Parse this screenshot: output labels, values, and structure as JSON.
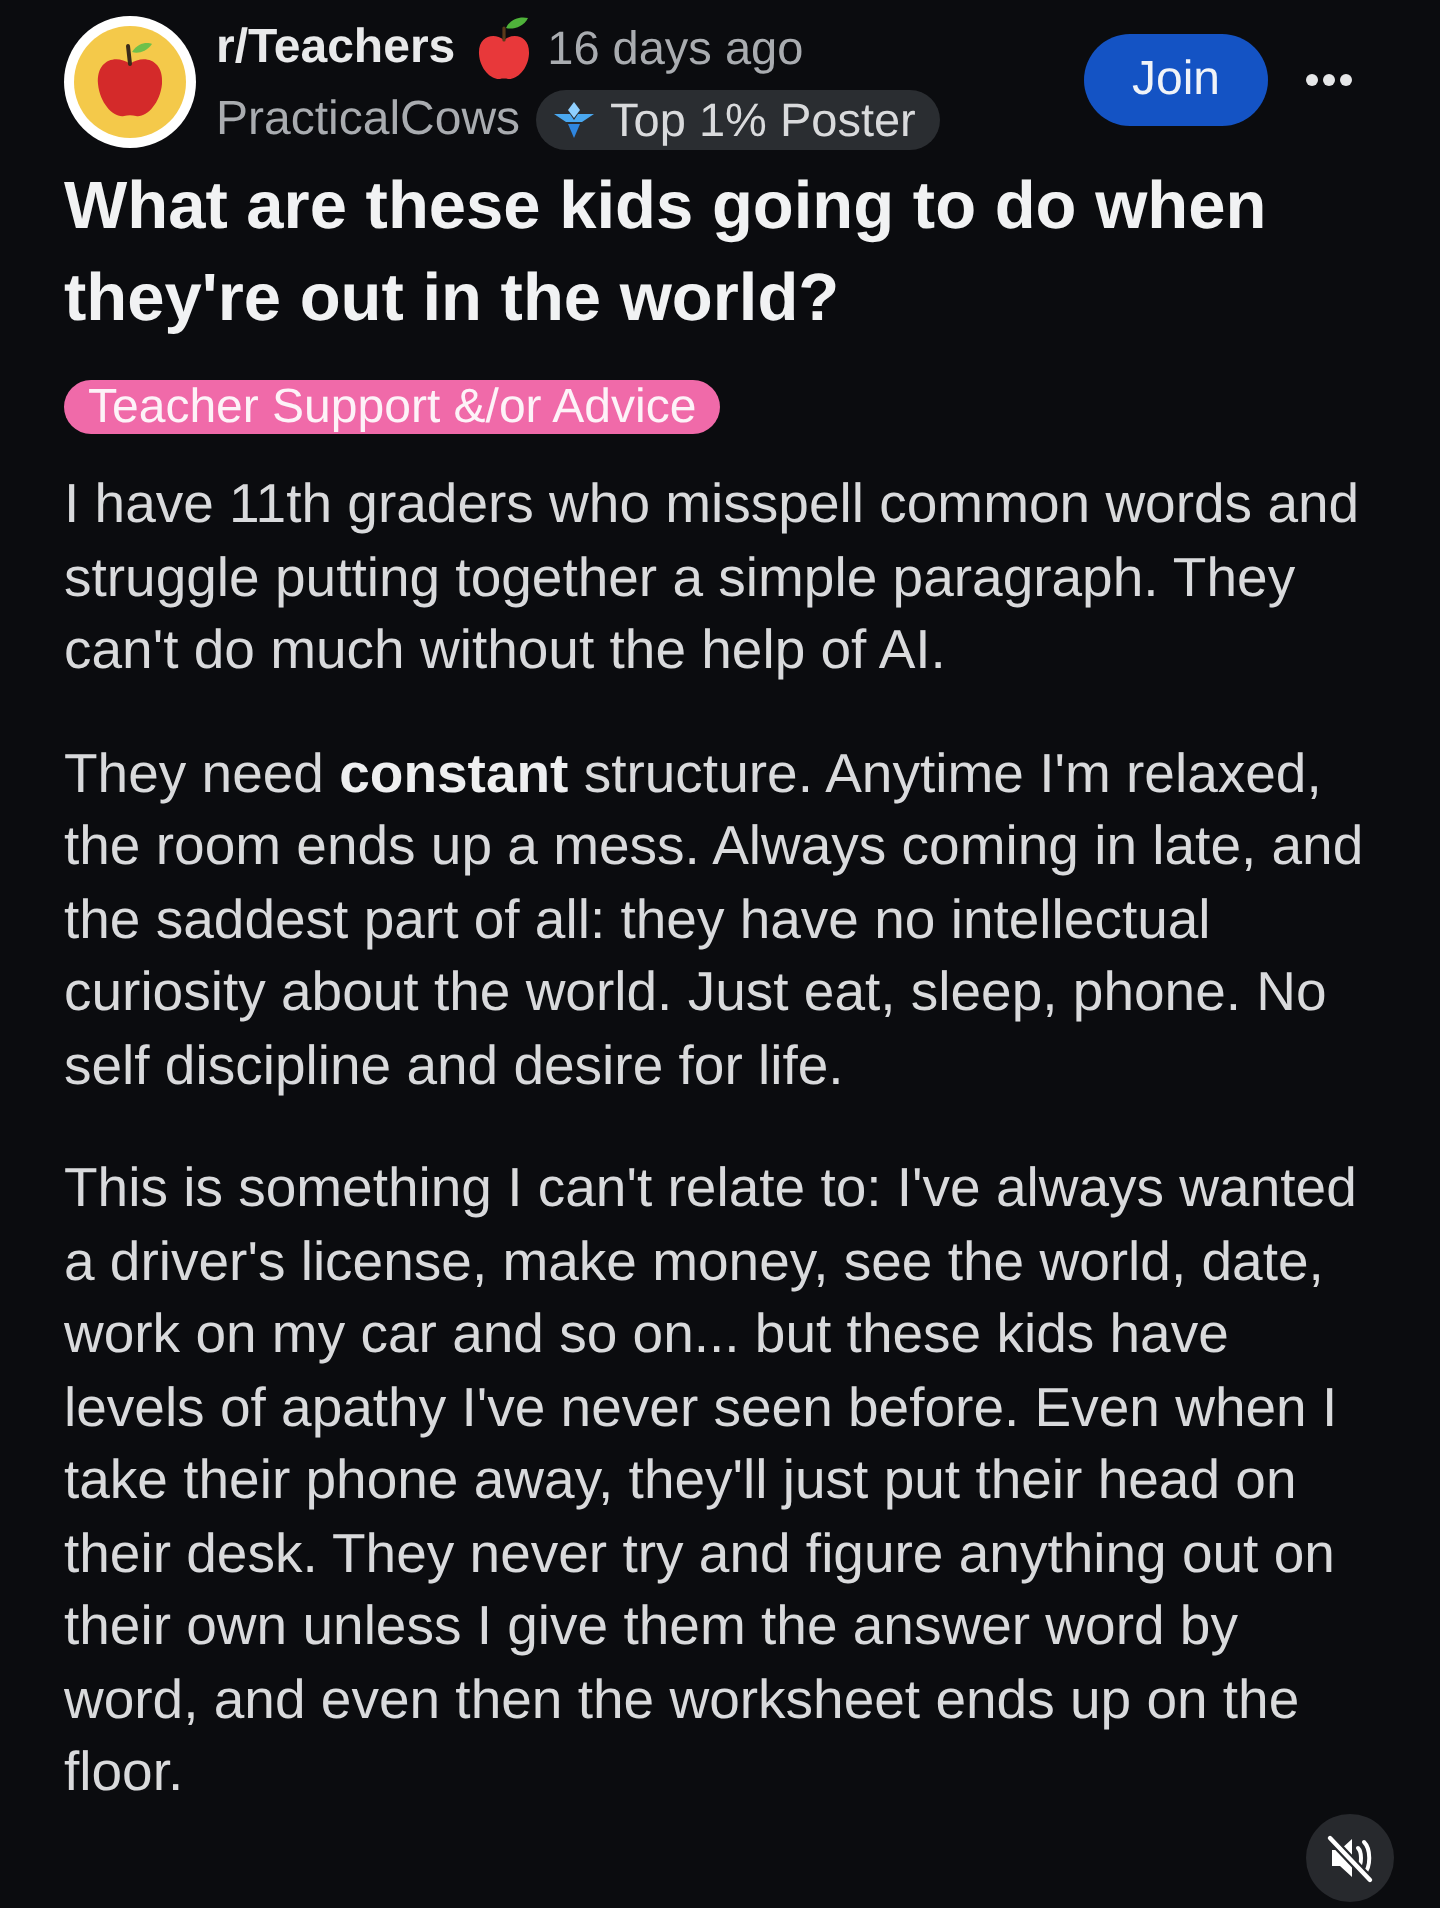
{
  "post": {
    "subreddit": "r/Teachers",
    "time": "16 days ago",
    "author": "PracticalCows",
    "badge": "Top 1% Poster",
    "join_button": "Join",
    "title": "What are these kids going to do when they're out in the world?",
    "flair": "Teacher Support &/or Advice",
    "paragraphs": [
      "I have 11th graders who misspell common words and struggle putting together a simple paragraph. They can't do much without the help of AI.",
      "They need **constant** structure. Anytime I'm relaxed, the room ends up a mess. Always coming in late, and the saddest part of all: they have no intellectual curiosity about the world. Just eat, sleep, phone. No self discipline and desire for life.",
      "This is something I can't relate to: I've always wanted a driver's license, make money, see the world, date, work on my car and so on... but these kids have levels of apathy I've never seen before. Even when I take their phone away, they'll just put their head on their desk. They never try and figure anything out on their own unless I give them the answer word by word, and even then the worksheet ends up on the floor."
    ]
  },
  "video_controls": {
    "muted": true
  }
}
